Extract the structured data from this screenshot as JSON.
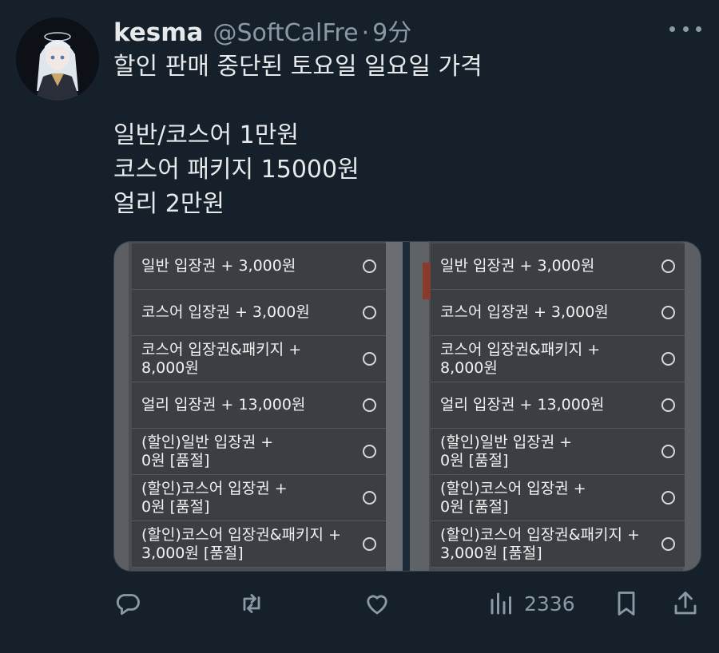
{
  "tweet": {
    "display_name": "kesma",
    "handle": "@SoftCalFre",
    "separator": "·",
    "time": "9分",
    "text_lines": [
      "할인 판매 중단된 토요일 일요일 가격",
      "",
      "일반/코스어 1만원",
      "코스어 패키지 15000원",
      "얼리 2만원"
    ]
  },
  "media": {
    "left_options": [
      "일반 입장권  + 3,000원",
      "코스어 입장권  + 3,000원",
      "코스어 입장권&패키지  +\n8,000원",
      "얼리 입장권  + 13,000원",
      "(할인)일반 입장권  +\n0원  [품절]",
      "(할인)코스어 입장권  +\n0원  [품절]",
      "(할인)코스어 입장권&패키지  +\n3,000원  [품절]"
    ],
    "right_options": [
      "일반 입장권  + 3,000원",
      "코스어 입장권  + 3,000원",
      "코스어 입장권&패키지  +\n8,000원",
      "얼리 입장권  + 13,000원",
      "(할인)일반 입장권  +\n0원  [품절]",
      "(할인)코스어 입장권  +\n0원  [품절]",
      "(할인)코스어 입장권&패키지  +\n3,000원  [품절]"
    ]
  },
  "actions": {
    "views": "2336"
  },
  "colors": {
    "background": "#15202b",
    "text": "#e7e9ea",
    "muted": "#8b98a5"
  },
  "icons": [
    "more-icon",
    "reply-icon",
    "retweet-icon",
    "like-icon",
    "views-icon",
    "bookmark-icon",
    "share-icon"
  ]
}
